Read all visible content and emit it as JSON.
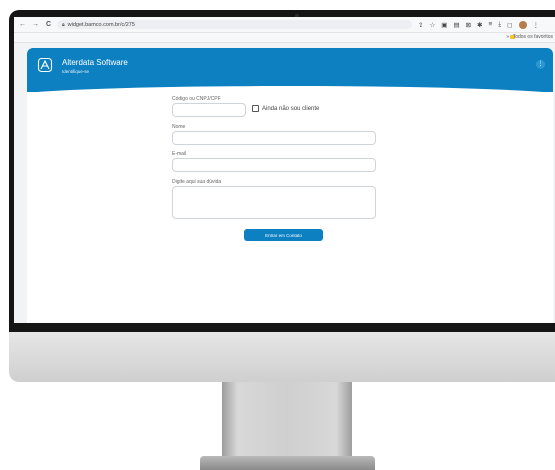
{
  "browser": {
    "back_icon": "←",
    "forward_icon": "→",
    "reload_icon": "C",
    "url": "widget.bamco.com.br/c/275",
    "bookmarks_folder": "Todos os favoritos",
    "bookmarks_arrow": "»"
  },
  "widget": {
    "title": "Alterdata Software",
    "subtitle": "Identifique-se",
    "menu_icon": "⋮",
    "header_color": "#0d80c1"
  },
  "form": {
    "code_label": "Código ou CNPJ/CPF",
    "not_client_label": "Ainda não sou cliente",
    "name_label": "Nome",
    "email_label": "E-mail",
    "question_label": "Digite aqui sua dúvida",
    "submit_label": "Entrar em Contato"
  }
}
